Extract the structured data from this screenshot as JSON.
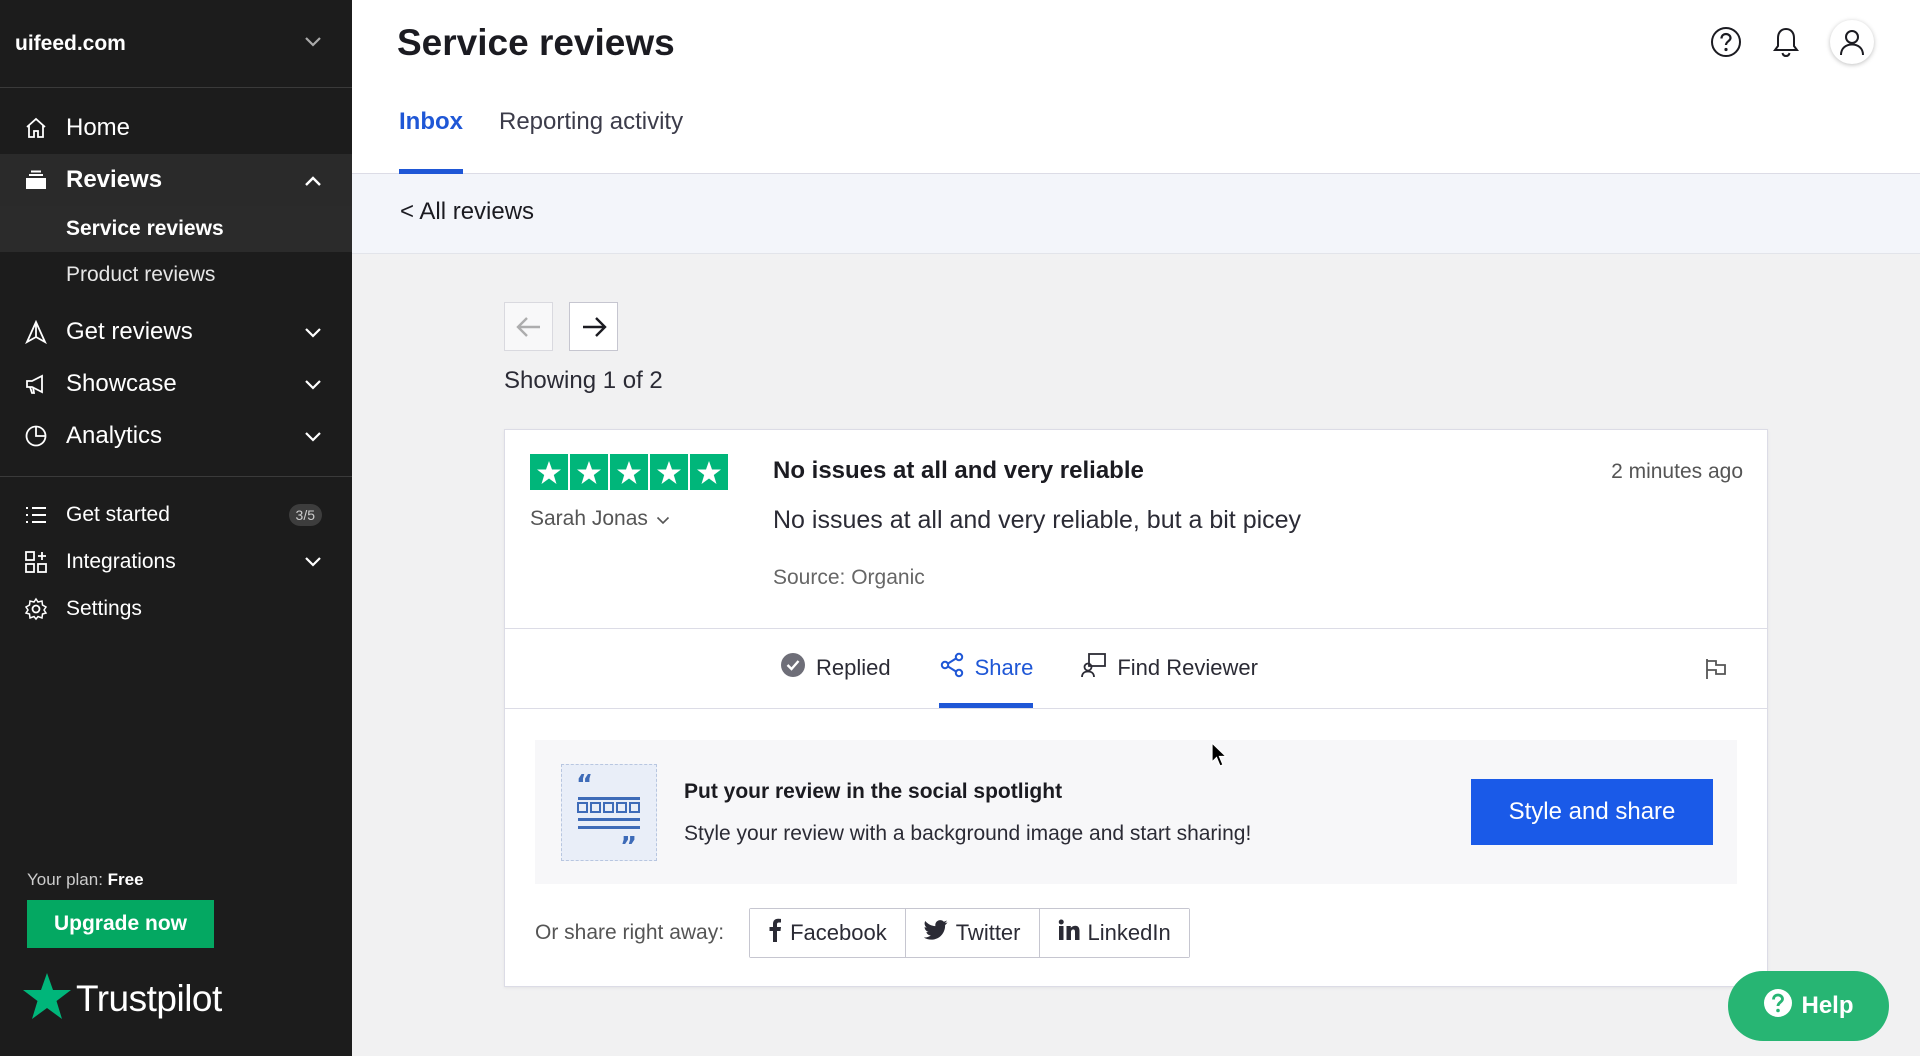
{
  "sidebar": {
    "domain": "uifeed.com",
    "nav": {
      "home": "Home",
      "reviews": "Reviews",
      "service_reviews": "Service reviews",
      "product_reviews": "Product reviews",
      "get_reviews": "Get reviews",
      "showcase": "Showcase",
      "analytics": "Analytics",
      "get_started": "Get started",
      "get_started_count": "3/5",
      "integrations": "Integrations",
      "settings": "Settings"
    },
    "plan_label": "Your plan:",
    "plan_value": "Free",
    "upgrade_label": "Upgrade now",
    "logo_text": "Trustpilot"
  },
  "header": {
    "title": "Service reviews",
    "tabs": [
      "Inbox",
      "Reporting activity"
    ]
  },
  "breadcrumb": "< All reviews",
  "pager": {
    "showing": "Showing 1 of 2"
  },
  "review": {
    "rating": 5,
    "reviewer": "Sarah Jonas",
    "title": "No issues at all and very reliable",
    "time": "2 minutes ago",
    "text": "No issues at all and very reliable, but a bit picey",
    "source": "Source: Organic",
    "actions": {
      "replied": "Replied",
      "share": "Share",
      "find_reviewer": "Find Reviewer"
    }
  },
  "spotlight": {
    "title": "Put your review in the social spotlight",
    "text": "Style your review with a background image and start sharing!",
    "button": "Style and share"
  },
  "share": {
    "label": "Or share right away:",
    "facebook": "Facebook",
    "twitter": "Twitter",
    "linkedin": "LinkedIn"
  },
  "help_label": "Help",
  "colors": {
    "sidebar_bg": "#1c1c1c",
    "accent_blue": "#1f57d6",
    "trustpilot_green": "#00b67a",
    "upgrade_green": "#04a862"
  }
}
